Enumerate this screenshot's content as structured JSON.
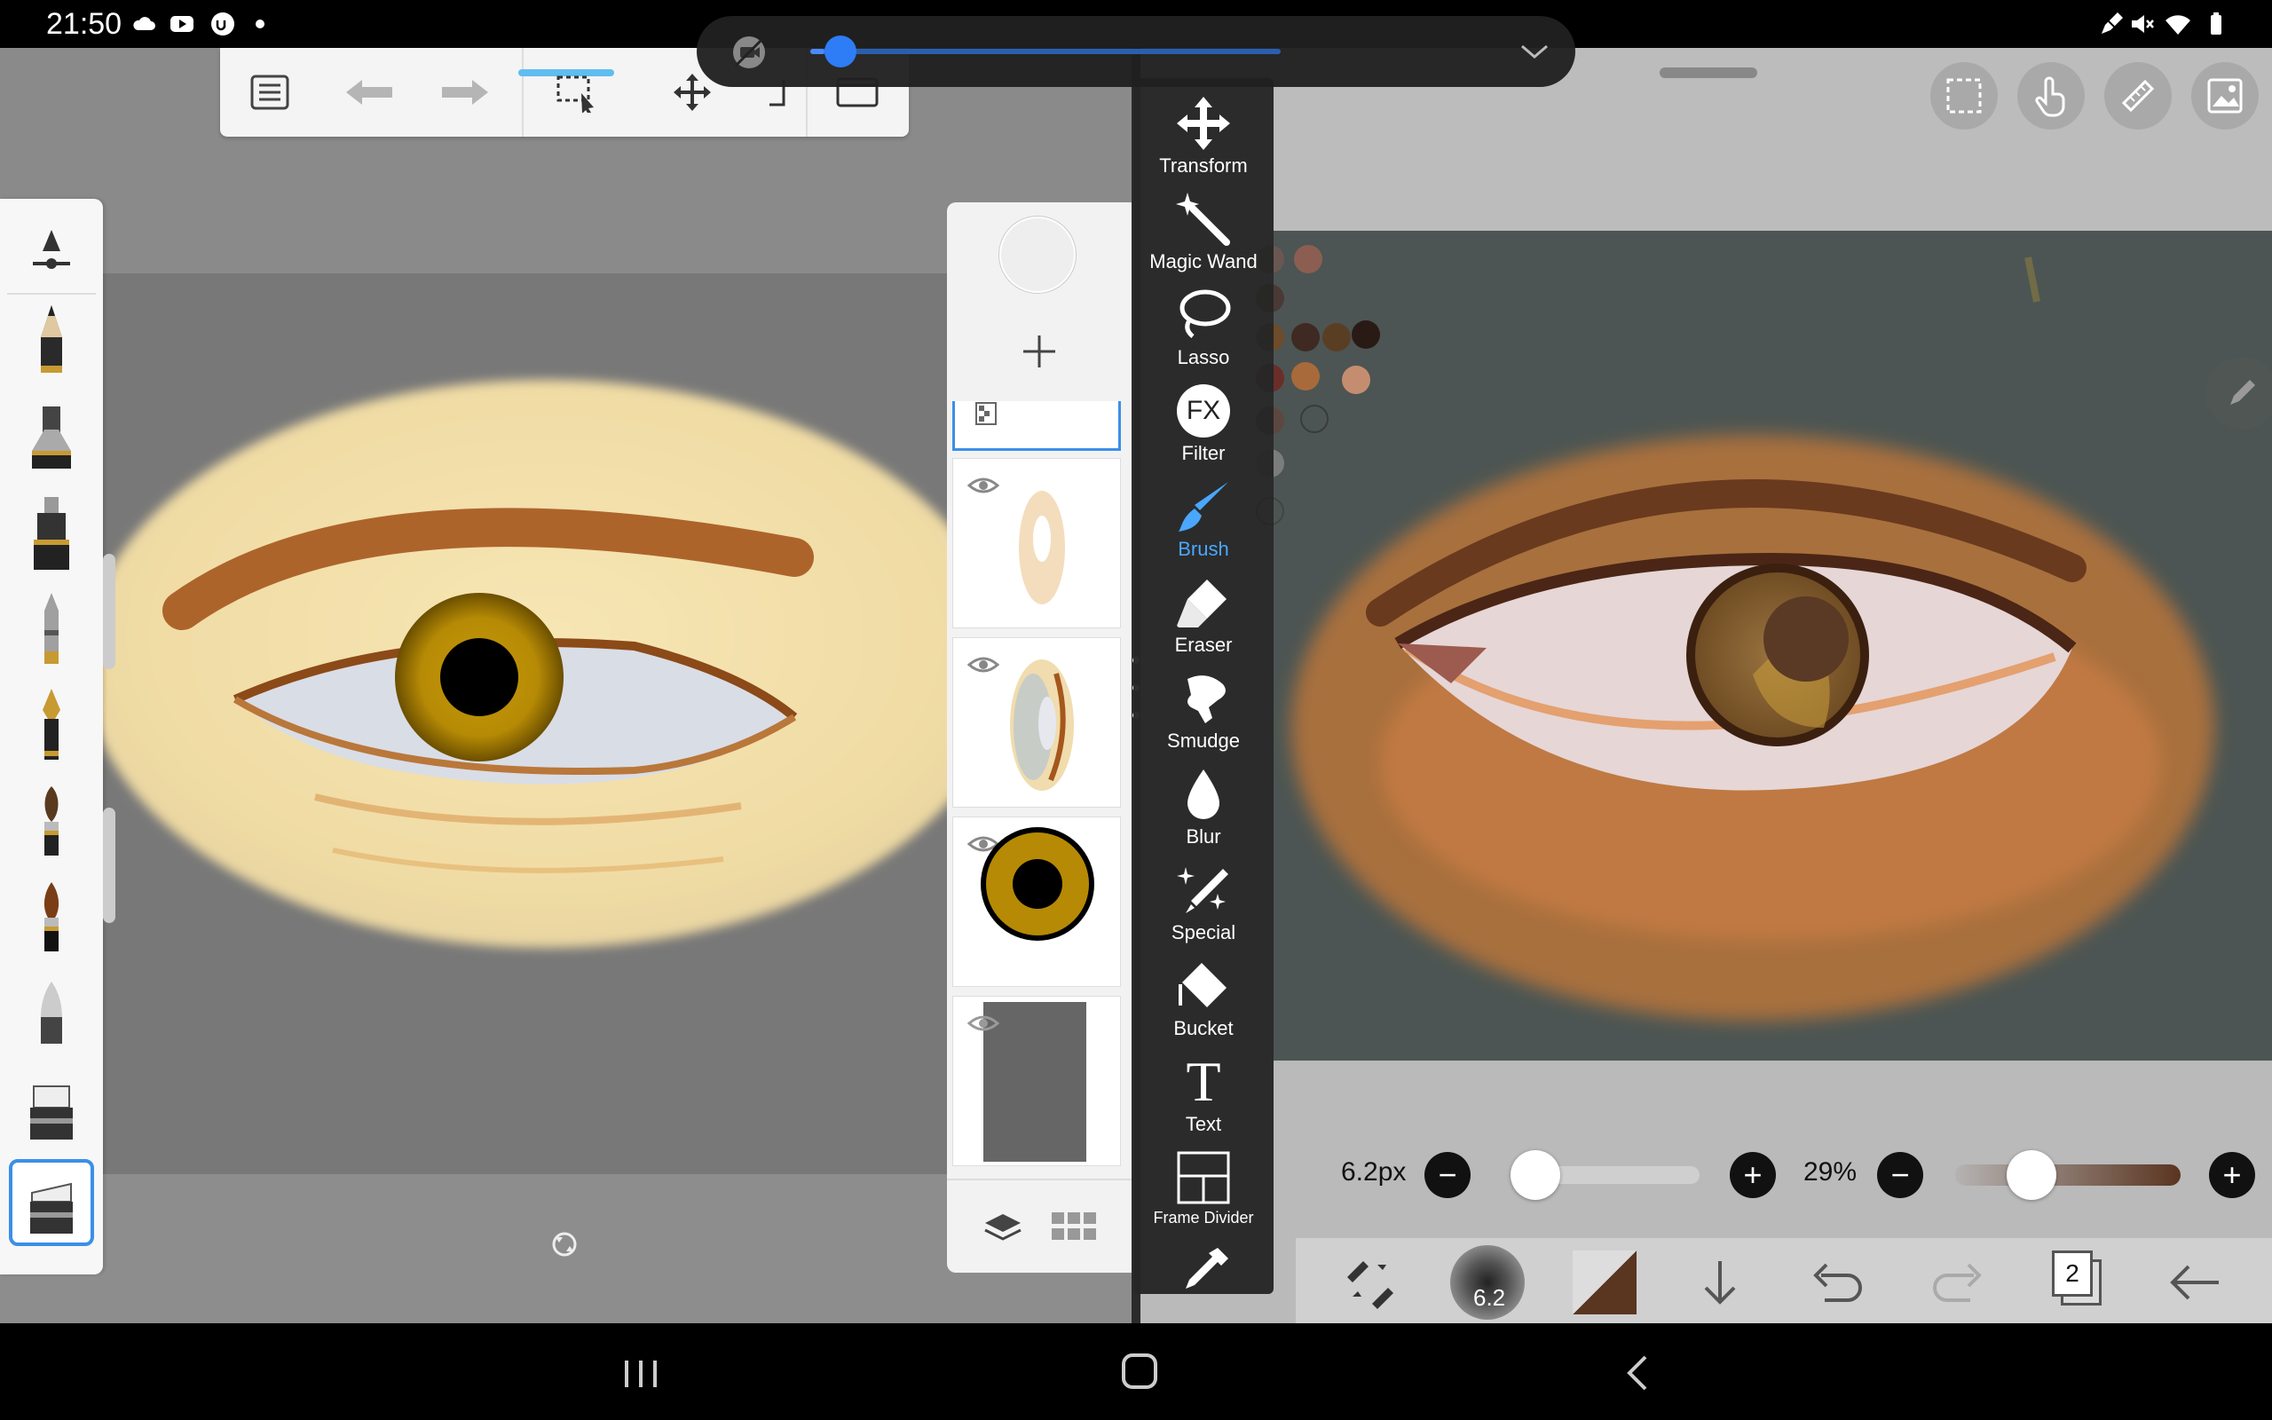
{
  "status_bar": {
    "time": "21:50",
    "left_icons": [
      "cloud-icon",
      "youtube-icon",
      "app-icon",
      "dot-icon"
    ],
    "right_icons": [
      "pen-icon",
      "mute-icon",
      "wifi-icon",
      "battery-icon"
    ]
  },
  "media_control": {
    "icons": [
      "no-video-icon",
      "chevron-down-icon"
    ],
    "progress": 0.03
  },
  "left_app": {
    "toolbar_icons": [
      "list-icon",
      "undo-icon",
      "redo-icon",
      "selection-icon",
      "move-icon",
      "crop-icon",
      "frame-icon"
    ],
    "brush_slots": [
      "brush-size-icon",
      "pencil-icon",
      "ink-pen-icon",
      "technical-pen-icon",
      "marker-icon",
      "fountain-pen-icon",
      "round-brush-icon",
      "flat-brush-icon",
      "airbrush-icon",
      "eraser-icon",
      "smudge-eraser-icon"
    ],
    "layers_icons": [
      "color-circle-icon",
      "add-layer-icon",
      "layers-icon",
      "grid-icon"
    ],
    "canvas_tool_icon": "rotate-icon"
  },
  "tool_menu": {
    "items": [
      {
        "label": "Transform",
        "icon": "transform-icon",
        "active": false
      },
      {
        "label": "Magic Wand",
        "icon": "magic-wand-icon",
        "active": false
      },
      {
        "label": "Lasso",
        "icon": "lasso-icon",
        "active": false
      },
      {
        "label": "Filter",
        "icon": "filter-icon",
        "active": false,
        "icon_text": "FX"
      },
      {
        "label": "Brush",
        "icon": "brush-icon",
        "active": true
      },
      {
        "label": "Eraser",
        "icon": "eraser-icon",
        "active": false
      },
      {
        "label": "Smudge",
        "icon": "smudge-icon",
        "active": false
      },
      {
        "label": "Blur",
        "icon": "blur-icon",
        "active": false
      },
      {
        "label": "Special",
        "icon": "special-icon",
        "active": false
      },
      {
        "label": "Bucket",
        "icon": "bucket-icon",
        "active": false
      },
      {
        "label": "Text",
        "icon": "text-icon",
        "active": false,
        "icon_text": "T"
      },
      {
        "label": "Frame Divider",
        "icon": "frame-divider-icon",
        "active": false
      },
      {
        "label": "",
        "icon": "eyedropper-icon",
        "active": false
      }
    ],
    "accent_color": "#4aa7ff"
  },
  "right_app": {
    "top_icons": [
      "selection-icon",
      "finger-icon",
      "ruler-icon",
      "image-icon"
    ],
    "brush_size": "6.2px",
    "opacity": "29%",
    "brush_size_level": 0.05,
    "opacity_level": 0.29,
    "bottom_toolbar": {
      "brush_preview_value": "6.2",
      "layer_count": "2",
      "icons": [
        "swap-tools-icon",
        "brush-preview-icon",
        "color-swatch-icon",
        "down-arrow-icon",
        "undo-icon",
        "redo-icon",
        "layers-count-icon",
        "back-arrow-icon"
      ],
      "color_swatch": "#5a3520"
    },
    "side_pen_icon": "pen-icon"
  },
  "palette": {
    "colors": [
      "#6b5752",
      "#8c5e52",
      "#4a3a35",
      "#6e4b2a",
      "#3e2a22",
      "#5a3e24",
      "#5e2f1f",
      "#2a1a16",
      "#6a2e2a",
      "#a86a3a",
      "#c58d70",
      "#5c4840",
      "#3a3b3a",
      "#7b7d7b",
      "#444"
    ]
  },
  "nav_bar": {
    "icons": [
      "recents-icon",
      "home-icon",
      "back-icon"
    ]
  }
}
